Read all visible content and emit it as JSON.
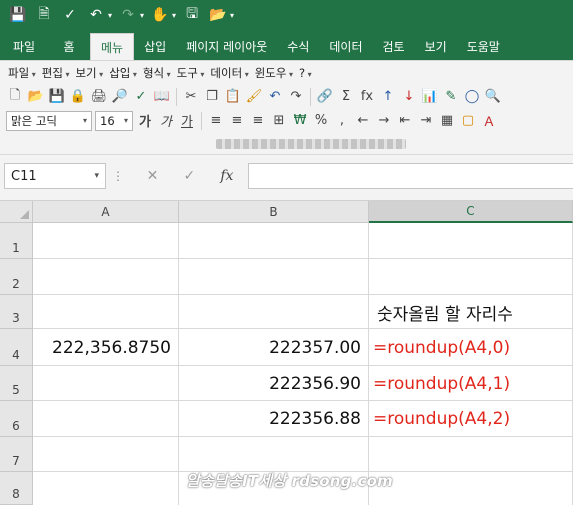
{
  "quick_access": {
    "icons": [
      "save-icon",
      "print-preview-icon",
      "spell-check-icon",
      "undo-icon",
      "redo-icon",
      "touch-mode-icon",
      "save-as-icon",
      "open-folder-icon",
      "customize-icon"
    ]
  },
  "ribbon": {
    "tabs": [
      "파일",
      "홈",
      "메뉴",
      "삽입",
      "페이지 레이아웃",
      "수식",
      "데이터",
      "검토",
      "보기",
      "도움말"
    ],
    "active_tab": "메뉴"
  },
  "menubar": {
    "items": [
      "파일",
      "편집",
      "보기",
      "삽입",
      "형식",
      "도구",
      "데이터",
      "윈도우",
      "?"
    ]
  },
  "toolbar": {
    "font_name": "맑은 고딕",
    "font_size": "16",
    "bold_label": "가",
    "italic_label": "가",
    "underline_label": "가",
    "percent_label": "%",
    "comma_label": ",",
    "fx_label": "fx"
  },
  "formula_bar": {
    "name_box": "C11",
    "fx_label": "fx",
    "formula": ""
  },
  "sheet": {
    "columns": [
      "A",
      "B",
      "C"
    ],
    "selected_column": "C",
    "rows": [
      "1",
      "2",
      "3",
      "4",
      "5",
      "6",
      "7",
      "8"
    ],
    "cells": {
      "C3": "숫자올림 할 자리수",
      "A4": "222,356.8750",
      "B4": "222357.00",
      "C4": "=roundup(A4,0)",
      "B5": "222356.90",
      "C5": "=roundup(A4,1)",
      "B6": "222356.88",
      "C6": "=roundup(A4,2)"
    }
  },
  "watermark": "알송달송IT세상 rdsong.com",
  "colors": {
    "excel_green": "#217346",
    "formula_red": "#e1261c"
  }
}
